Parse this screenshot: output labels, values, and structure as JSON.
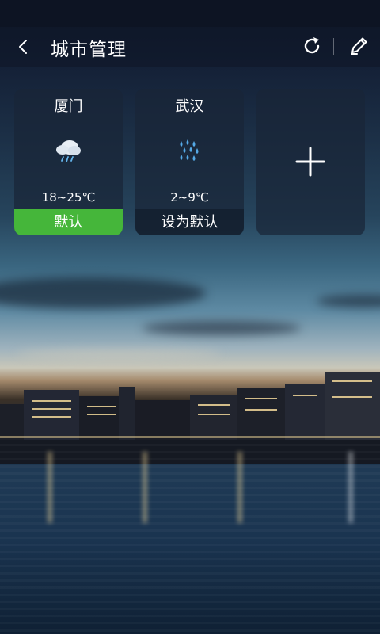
{
  "header": {
    "title": "城市管理",
    "back_icon": "back-chevron-icon",
    "refresh_icon": "refresh-icon",
    "edit_icon": "pencil-icon"
  },
  "cities": [
    {
      "name": "厦门",
      "icon": "rain-cloud-icon",
      "temp": "18~25℃",
      "button": "默认",
      "is_default": true
    },
    {
      "name": "武汉",
      "icon": "heavy-rain-icon",
      "temp": "2~9℃",
      "button": "设为默认",
      "is_default": false
    }
  ],
  "add_card": {
    "icon": "plus-icon"
  },
  "colors": {
    "default_button": "#45b63a",
    "card_background": "#192637",
    "text": "#ffffff"
  }
}
